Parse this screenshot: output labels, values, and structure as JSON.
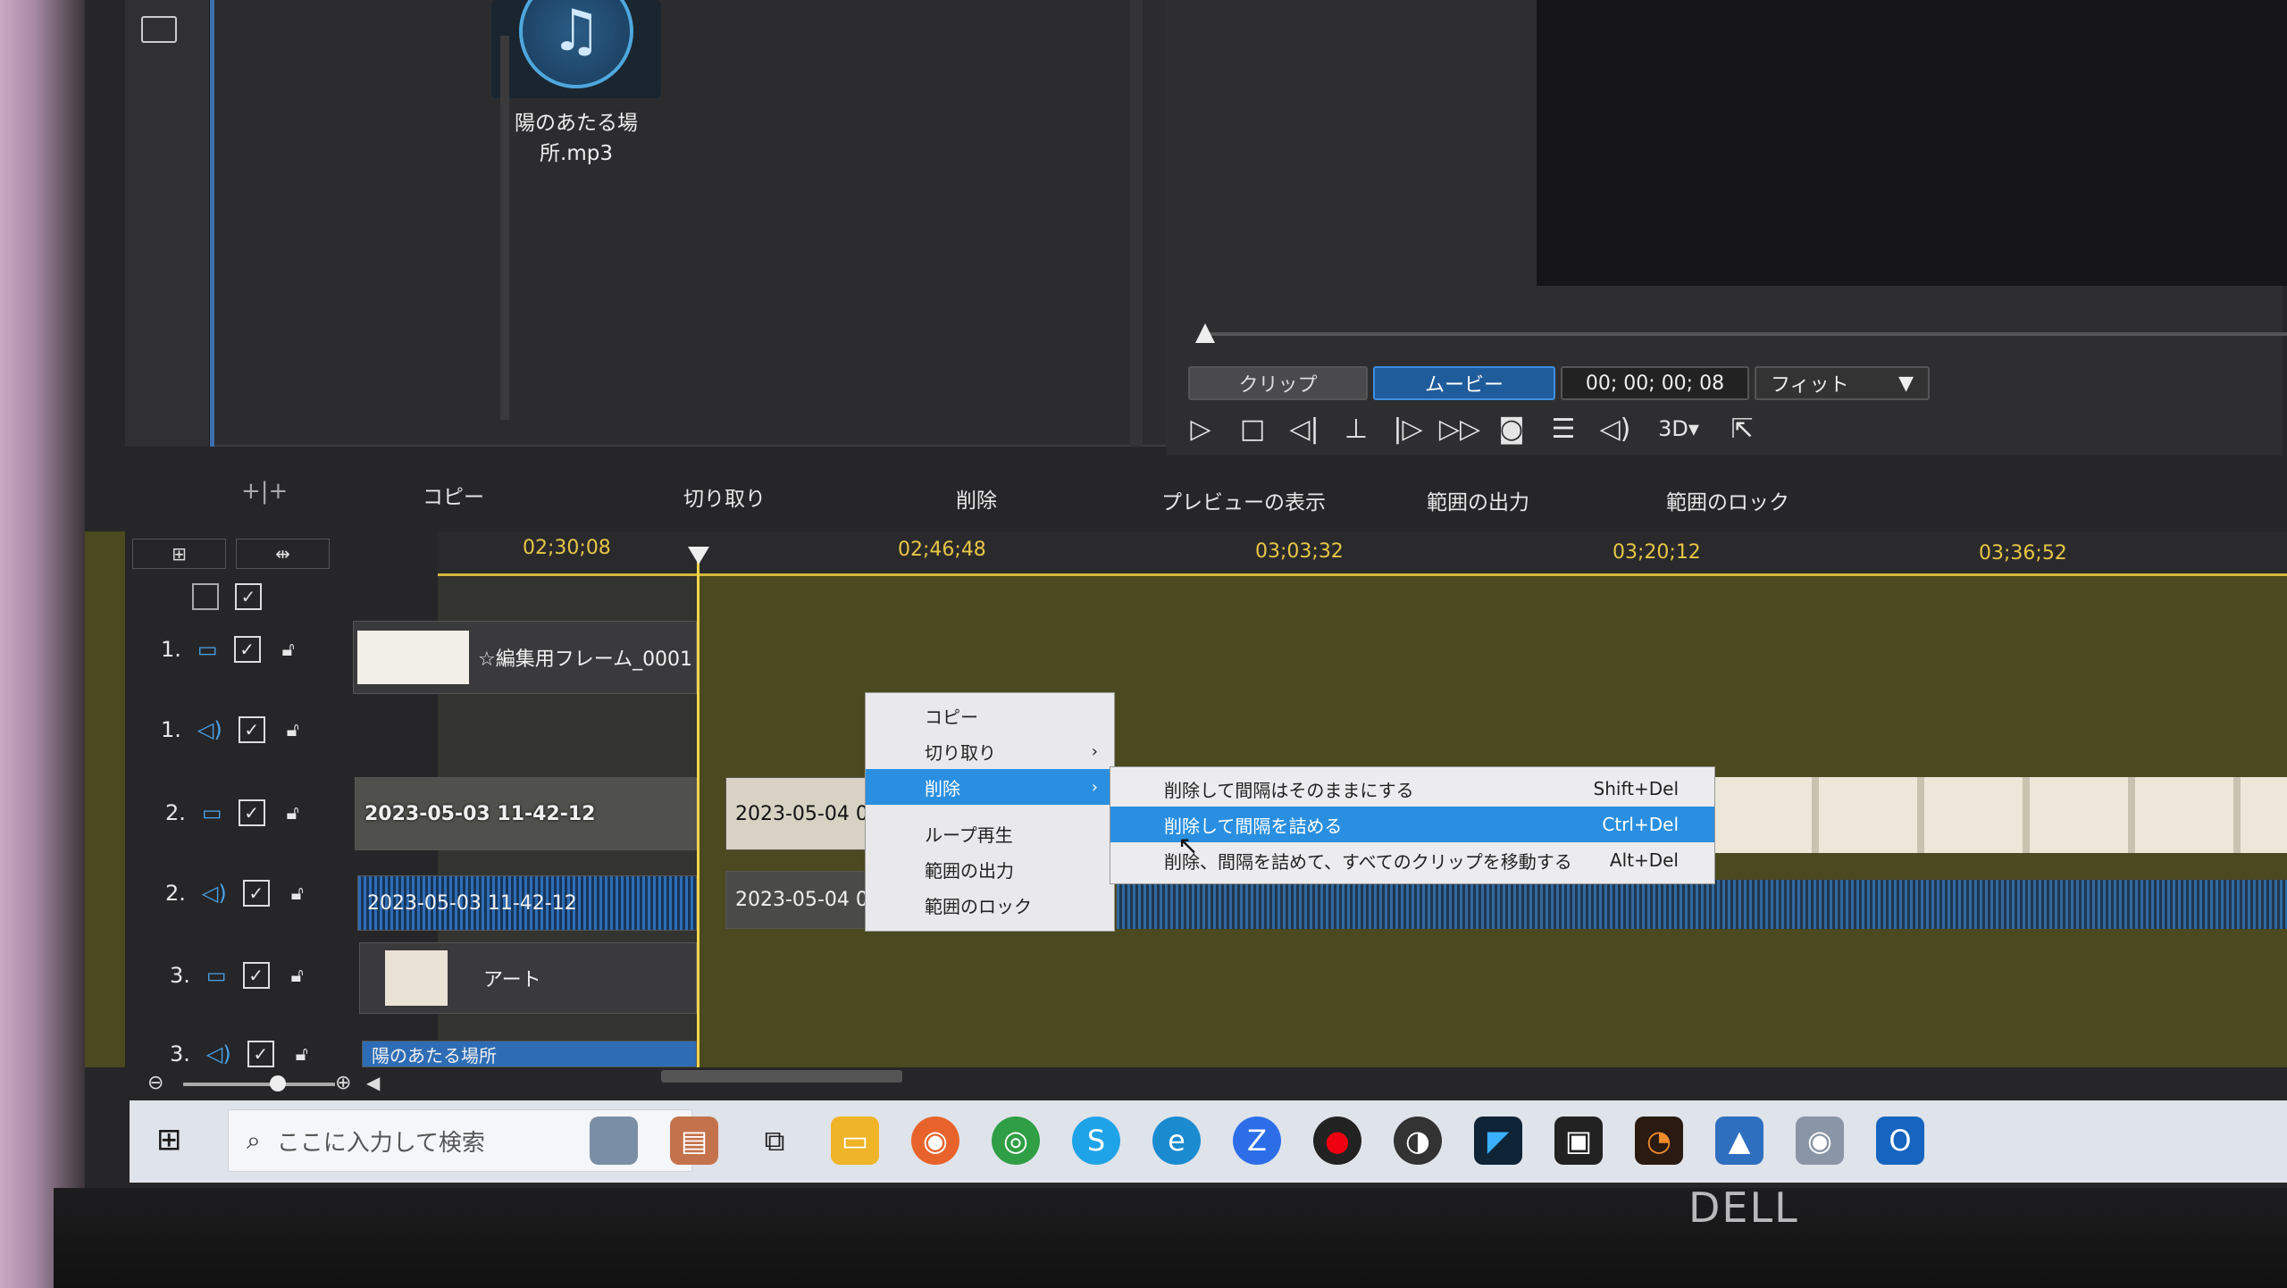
{
  "media": {
    "file_name": "陽のあたる場所.mp3"
  },
  "preview": {
    "mode_clip": "クリップ",
    "mode_movie": "ムービー",
    "timecode": "00; 00; 00; 08",
    "fit": "フィット",
    "three_d": "3D"
  },
  "toolbar": {
    "copy": "コピー",
    "cut": "切り取り",
    "delete": "削除",
    "show_preview": "プレビューの表示",
    "range_output": "範囲の出力",
    "range_lock": "範囲のロック"
  },
  "ruler": {
    "t1": "02;30;08",
    "t2": "02;46;48",
    "t3": "03;03;32",
    "t4": "03;20;12",
    "t5": "03;36;52"
  },
  "tracks": {
    "v1": "1.",
    "a1": "1.",
    "v2": "2.",
    "a2": "2.",
    "v3": "3.",
    "a3": "3."
  },
  "clips": {
    "frame": "☆編集用フレーム_0001",
    "video2": "2023-05-03 11-42-12",
    "audio2": "2023-05-03 11-42-12",
    "video2b": "2023-05-04 0",
    "audio2b": "2023-05-04 0",
    "art": "アート",
    "audio3": "陽のあたる場所"
  },
  "context_menu": {
    "copy": "コピー",
    "cut": "切り取り",
    "delete": "削除",
    "loop": "ループ再生",
    "range_output": "範囲の出力",
    "range_lock": "範囲のロック"
  },
  "submenu": {
    "item1": "削除して間隔はそのままにする",
    "item1_shortcut": "Shift+Del",
    "item2": "削除して間隔を詰める",
    "item2_shortcut": "Ctrl+Del",
    "item3": "削除、間隔を詰めて、すべてのクリップを移動する",
    "item3_shortcut": "Alt+Del"
  },
  "taskbar": {
    "search_placeholder": "ここに入力して検索"
  },
  "monitor": {
    "brand": "DELL"
  }
}
